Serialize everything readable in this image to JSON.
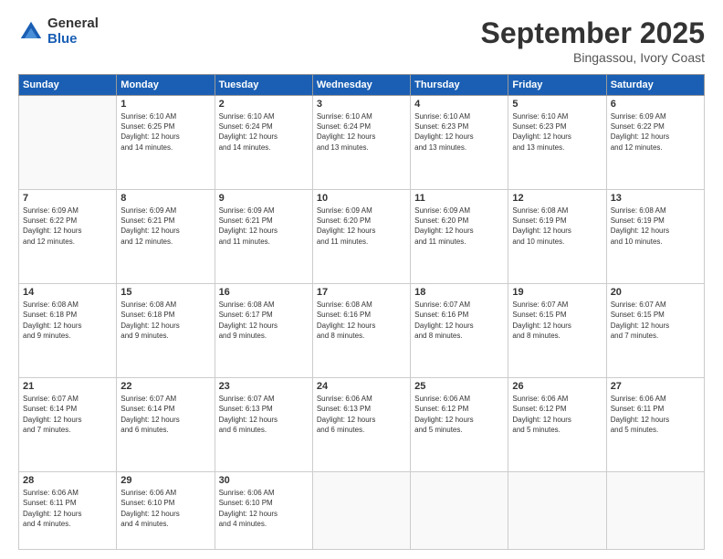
{
  "logo": {
    "general": "General",
    "blue": "Blue"
  },
  "header": {
    "month": "September 2025",
    "location": "Bingassou, Ivory Coast"
  },
  "weekdays": [
    "Sunday",
    "Monday",
    "Tuesday",
    "Wednesday",
    "Thursday",
    "Friday",
    "Saturday"
  ],
  "weeks": [
    [
      {
        "day": "",
        "info": ""
      },
      {
        "day": "1",
        "info": "Sunrise: 6:10 AM\nSunset: 6:25 PM\nDaylight: 12 hours\nand 14 minutes."
      },
      {
        "day": "2",
        "info": "Sunrise: 6:10 AM\nSunset: 6:24 PM\nDaylight: 12 hours\nand 14 minutes."
      },
      {
        "day": "3",
        "info": "Sunrise: 6:10 AM\nSunset: 6:24 PM\nDaylight: 12 hours\nand 13 minutes."
      },
      {
        "day": "4",
        "info": "Sunrise: 6:10 AM\nSunset: 6:23 PM\nDaylight: 12 hours\nand 13 minutes."
      },
      {
        "day": "5",
        "info": "Sunrise: 6:10 AM\nSunset: 6:23 PM\nDaylight: 12 hours\nand 13 minutes."
      },
      {
        "day": "6",
        "info": "Sunrise: 6:09 AM\nSunset: 6:22 PM\nDaylight: 12 hours\nand 12 minutes."
      }
    ],
    [
      {
        "day": "7",
        "info": "Sunrise: 6:09 AM\nSunset: 6:22 PM\nDaylight: 12 hours\nand 12 minutes."
      },
      {
        "day": "8",
        "info": "Sunrise: 6:09 AM\nSunset: 6:21 PM\nDaylight: 12 hours\nand 12 minutes."
      },
      {
        "day": "9",
        "info": "Sunrise: 6:09 AM\nSunset: 6:21 PM\nDaylight: 12 hours\nand 11 minutes."
      },
      {
        "day": "10",
        "info": "Sunrise: 6:09 AM\nSunset: 6:20 PM\nDaylight: 12 hours\nand 11 minutes."
      },
      {
        "day": "11",
        "info": "Sunrise: 6:09 AM\nSunset: 6:20 PM\nDaylight: 12 hours\nand 11 minutes."
      },
      {
        "day": "12",
        "info": "Sunrise: 6:08 AM\nSunset: 6:19 PM\nDaylight: 12 hours\nand 10 minutes."
      },
      {
        "day": "13",
        "info": "Sunrise: 6:08 AM\nSunset: 6:19 PM\nDaylight: 12 hours\nand 10 minutes."
      }
    ],
    [
      {
        "day": "14",
        "info": "Sunrise: 6:08 AM\nSunset: 6:18 PM\nDaylight: 12 hours\nand 9 minutes."
      },
      {
        "day": "15",
        "info": "Sunrise: 6:08 AM\nSunset: 6:18 PM\nDaylight: 12 hours\nand 9 minutes."
      },
      {
        "day": "16",
        "info": "Sunrise: 6:08 AM\nSunset: 6:17 PM\nDaylight: 12 hours\nand 9 minutes."
      },
      {
        "day": "17",
        "info": "Sunrise: 6:08 AM\nSunset: 6:16 PM\nDaylight: 12 hours\nand 8 minutes."
      },
      {
        "day": "18",
        "info": "Sunrise: 6:07 AM\nSunset: 6:16 PM\nDaylight: 12 hours\nand 8 minutes."
      },
      {
        "day": "19",
        "info": "Sunrise: 6:07 AM\nSunset: 6:15 PM\nDaylight: 12 hours\nand 8 minutes."
      },
      {
        "day": "20",
        "info": "Sunrise: 6:07 AM\nSunset: 6:15 PM\nDaylight: 12 hours\nand 7 minutes."
      }
    ],
    [
      {
        "day": "21",
        "info": "Sunrise: 6:07 AM\nSunset: 6:14 PM\nDaylight: 12 hours\nand 7 minutes."
      },
      {
        "day": "22",
        "info": "Sunrise: 6:07 AM\nSunset: 6:14 PM\nDaylight: 12 hours\nand 6 minutes."
      },
      {
        "day": "23",
        "info": "Sunrise: 6:07 AM\nSunset: 6:13 PM\nDaylight: 12 hours\nand 6 minutes."
      },
      {
        "day": "24",
        "info": "Sunrise: 6:06 AM\nSunset: 6:13 PM\nDaylight: 12 hours\nand 6 minutes."
      },
      {
        "day": "25",
        "info": "Sunrise: 6:06 AM\nSunset: 6:12 PM\nDaylight: 12 hours\nand 5 minutes."
      },
      {
        "day": "26",
        "info": "Sunrise: 6:06 AM\nSunset: 6:12 PM\nDaylight: 12 hours\nand 5 minutes."
      },
      {
        "day": "27",
        "info": "Sunrise: 6:06 AM\nSunset: 6:11 PM\nDaylight: 12 hours\nand 5 minutes."
      }
    ],
    [
      {
        "day": "28",
        "info": "Sunrise: 6:06 AM\nSunset: 6:11 PM\nDaylight: 12 hours\nand 4 minutes."
      },
      {
        "day": "29",
        "info": "Sunrise: 6:06 AM\nSunset: 6:10 PM\nDaylight: 12 hours\nand 4 minutes."
      },
      {
        "day": "30",
        "info": "Sunrise: 6:06 AM\nSunset: 6:10 PM\nDaylight: 12 hours\nand 4 minutes."
      },
      {
        "day": "",
        "info": ""
      },
      {
        "day": "",
        "info": ""
      },
      {
        "day": "",
        "info": ""
      },
      {
        "day": "",
        "info": ""
      }
    ]
  ]
}
